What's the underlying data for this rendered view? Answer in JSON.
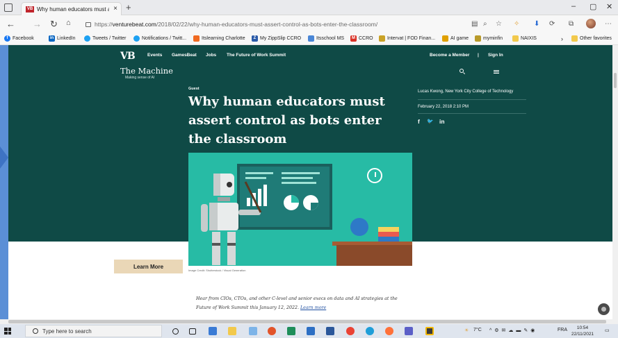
{
  "browser": {
    "tab_title": "Why human educators must asse",
    "tab_close": "×",
    "new_tab": "+",
    "window_controls": {
      "minimize": "–",
      "restore": "▢",
      "close": "✕"
    },
    "url_prefix": "https://",
    "url_domain": "venturebeat.com",
    "url_path": "/2018/02/22/why-human-educators-must-assert-control-as-bots-enter-the-classroom/",
    "bookmarks": [
      "Facebook",
      "LinkedIn",
      "Tweets / Twitter",
      "Notifications / Twitt...",
      "Itslearning Charlotte",
      "My ZippSlip CCRO",
      "Itsschool MS",
      "CCRO",
      "Intervat | FOD Finan...",
      "AI game",
      "myminfin",
      "NAIXIS",
      "Other favorites"
    ]
  },
  "site": {
    "logo": "VB",
    "nav": [
      "Events",
      "GamesBeat",
      "Jobs",
      "The Future of Work Summit"
    ],
    "become_member": "Become a Member",
    "sign_in": "Sign In",
    "separator": "|",
    "section_title": "The Machine",
    "section_subtitle": "Making sense of AI"
  },
  "article": {
    "category": "Guest",
    "headline": "Why human educators must assert control as bots enter the classroom",
    "author": "Lucas Kwong, New York City College of Technology",
    "date": "February 22, 2018 2:10 PM",
    "social": [
      "f",
      "🐦",
      "in"
    ],
    "image_credit": "Image Credit: Shutterstock / Visual Generation",
    "learn_more": "Learn More",
    "intro": "Hear from CIOs, CTOs, and other C-level and senior execs on data and AI strategies at the Future of Work Summit this January 12, 2022.",
    "intro_link": "Learn more"
  },
  "taskbar": {
    "search_placeholder": "Type here to search",
    "weather": "7°C",
    "language": "FRA",
    "time": "10:54",
    "date": "22/11/2021"
  },
  "colors": {
    "hero_bg": "#0f4a46",
    "illustration_bg": "#27bba5",
    "learn_more_bg": "#ead7b7"
  }
}
